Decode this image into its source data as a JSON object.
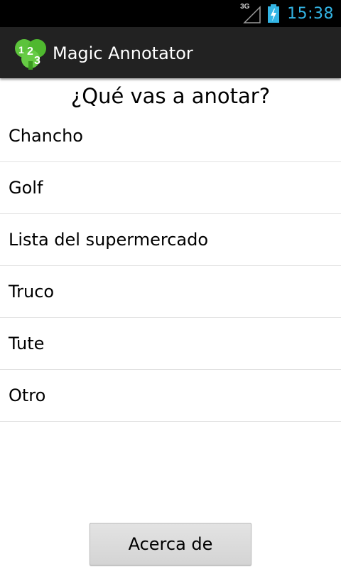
{
  "status_bar": {
    "network_type": "3G",
    "time": "15:38",
    "icons": [
      "signal-icon",
      "battery-charging-icon"
    ],
    "clock_color": "#33b5e5"
  },
  "action_bar": {
    "app_title": "Magic Annotator",
    "logo_icon": "app-logo-icon",
    "background": "#222222"
  },
  "main": {
    "heading": "¿Qué vas a anotar?",
    "items": [
      {
        "label": "Chancho"
      },
      {
        "label": "Golf"
      },
      {
        "label": "Lista del supermercado"
      },
      {
        "label": "Truco"
      },
      {
        "label": "Tute"
      },
      {
        "label": "Otro"
      }
    ]
  },
  "footer": {
    "about_label": "Acerca de"
  }
}
